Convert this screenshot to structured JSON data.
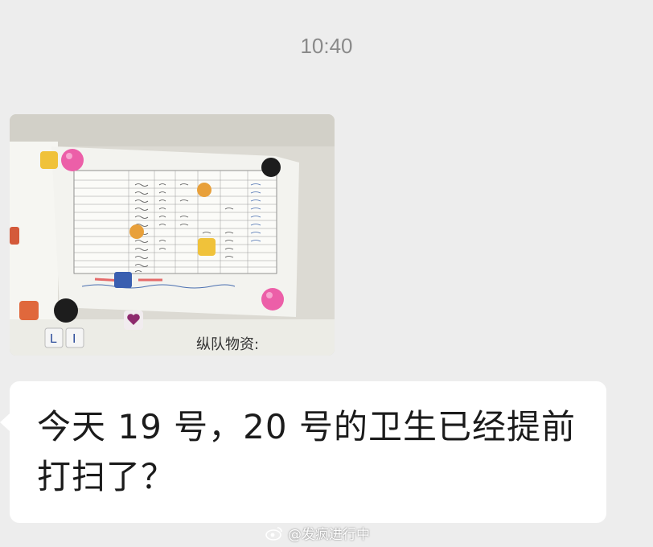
{
  "chat": {
    "timestamp": "10:40",
    "image_message": {
      "handwriting": "纵队物资:"
    },
    "text_message": {
      "text": "今天 19 号，20 号的卫生已经提前打扫了？"
    }
  },
  "watermark": {
    "icon": "weibo-logo",
    "text": "@发疯进行中"
  }
}
